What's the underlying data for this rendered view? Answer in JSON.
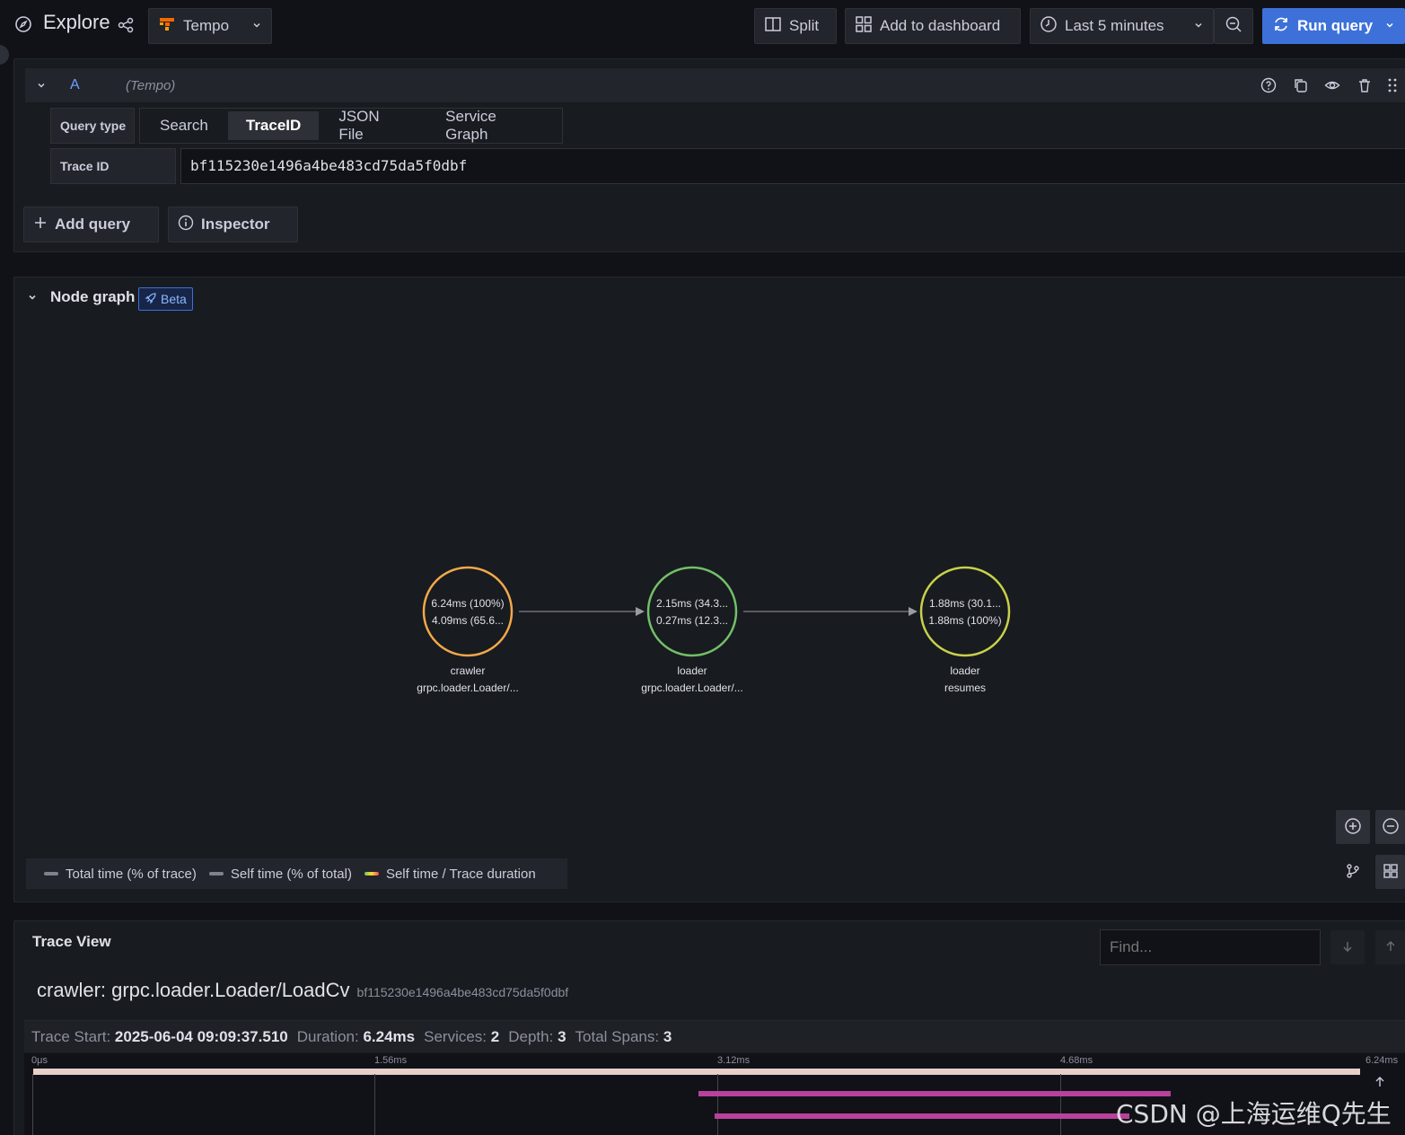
{
  "header": {
    "title": "Explore",
    "datasource": "Tempo",
    "split_label": "Split",
    "add_dashboard_label": "Add to dashboard",
    "time_range": "Last 5 minutes",
    "run_query_label": "Run query"
  },
  "query": {
    "ref_id": "A",
    "datasource_hint": "(Tempo)",
    "query_type_label": "Query type",
    "query_types": [
      "Search",
      "TraceID",
      "JSON File",
      "Service Graph"
    ],
    "active_query_type": "TraceID",
    "trace_id_label": "Trace ID",
    "trace_id_value": "bf115230e1496a4be483cd75da5f0dbf",
    "add_query_label": "Add query",
    "inspector_label": "Inspector"
  },
  "node_graph": {
    "title": "Node graph",
    "badge": "Beta",
    "nodes": [
      {
        "line1": "6.24ms (100%)",
        "line2": "4.09ms (65.6...",
        "title": "crawler",
        "subtitle": "grpc.loader.Loader/...",
        "color": "#f2a84a"
      },
      {
        "line1": "2.15ms (34.3...",
        "line2": "0.27ms (12.3...",
        "title": "loader",
        "subtitle": "grpc.loader.Loader/...",
        "color": "#73bf69"
      },
      {
        "line1": "1.88ms (30.1...",
        "line2": "1.88ms (100%)",
        "title": "loader",
        "subtitle": "resumes",
        "color": "#c8d14a"
      }
    ],
    "legend": [
      "Total time (% of trace)",
      "Self time (% of total)",
      "Self time / Trace duration"
    ]
  },
  "trace_view": {
    "title": "Trace View",
    "find_placeholder": "Find...",
    "trace_name": "crawler: grpc.loader.Loader/LoadCv",
    "trace_id": "bf115230e1496a4be483cd75da5f0dbf",
    "meta": [
      {
        "label": "Trace Start:",
        "value": "2025-06-04 09:09:37.510"
      },
      {
        "label": "Duration:",
        "value": "6.24ms"
      },
      {
        "label": "Services:",
        "value": "2"
      },
      {
        "label": "Depth:",
        "value": "3"
      },
      {
        "label": "Total Spans:",
        "value": "3"
      }
    ],
    "ticks": [
      "0μs",
      "1.56ms",
      "3.12ms",
      "4.68ms",
      "6.24ms"
    ]
  },
  "watermark": "CSDN @上海运维Q先生"
}
